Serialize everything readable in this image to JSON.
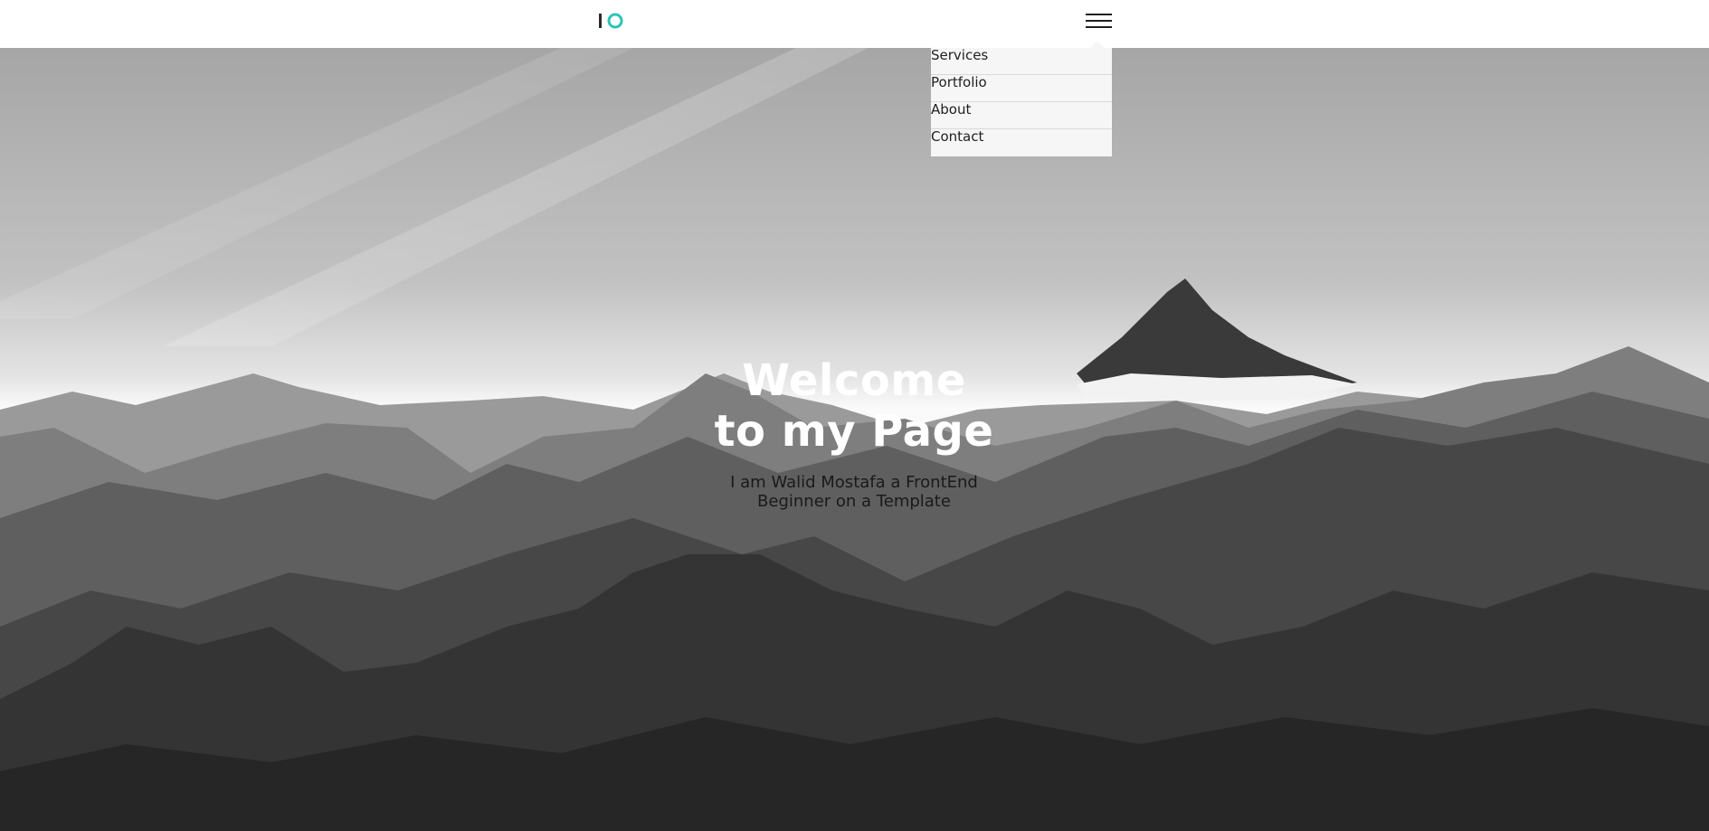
{
  "header": {
    "logo_text": "IO",
    "menu_icon": "hamburger-menu-icon",
    "accent_color": "#2ec4b6"
  },
  "nav": {
    "items": [
      {
        "label": "Services"
      },
      {
        "label": "Portfolio"
      },
      {
        "label": "About"
      },
      {
        "label": "Contact"
      }
    ]
  },
  "hero": {
    "title": "Welcome to my Page",
    "subtitle": "I am Walid Mostafa a FrontEnd Beginner on a Template",
    "background": "mountain-landscape-image"
  }
}
